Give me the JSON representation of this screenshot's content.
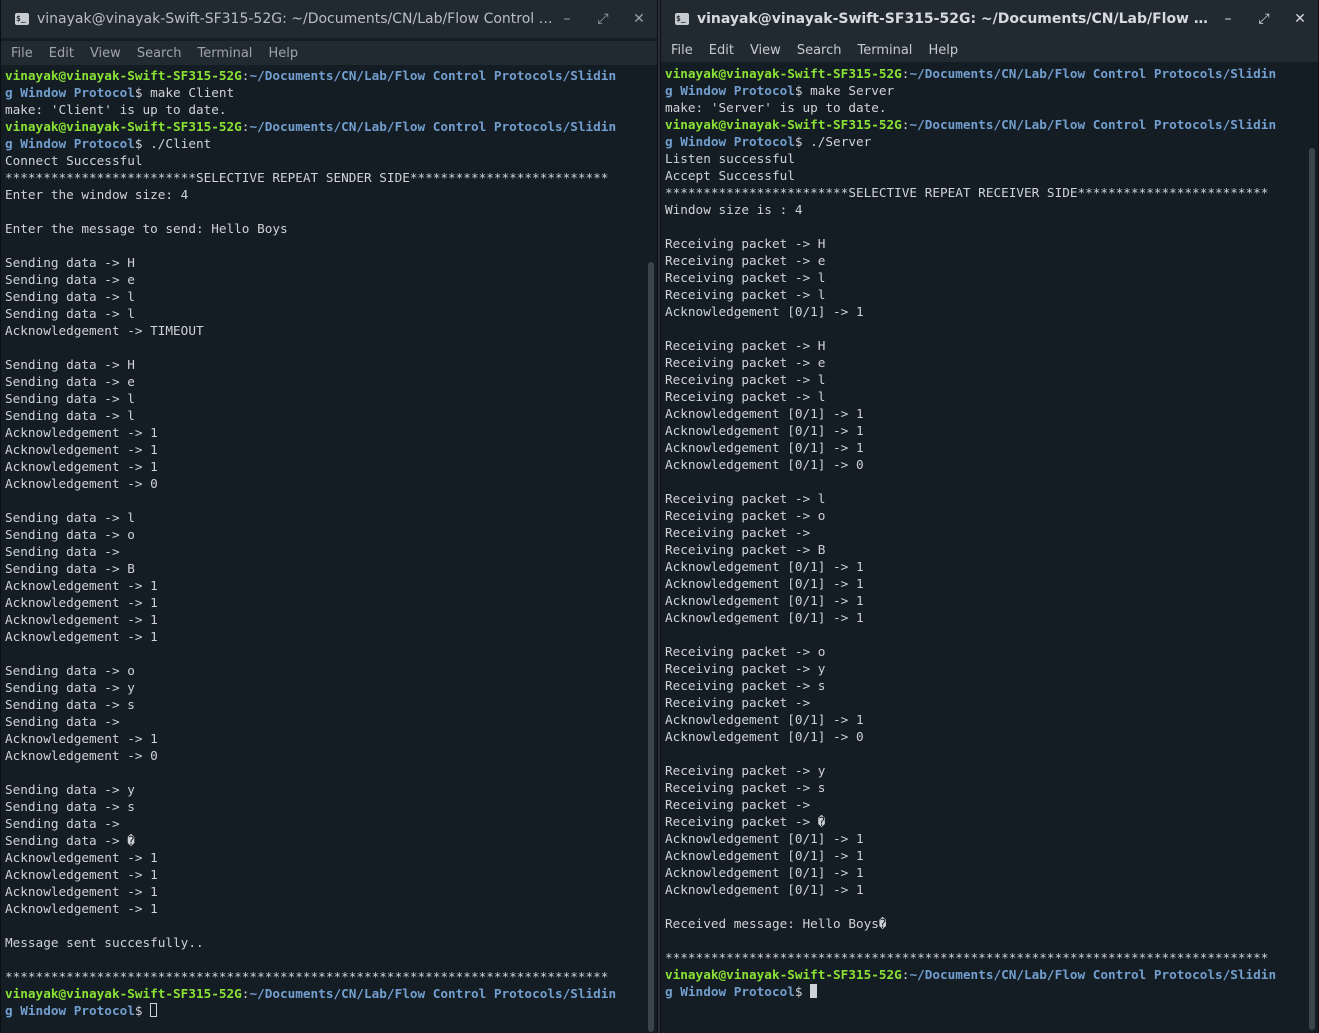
{
  "left": {
    "title": "vinayak@vinayak-Swift-SF315-52G: ~/Documents/CN/Lab/Flow Control Prot...",
    "icon": "terminal-icon",
    "menu": [
      "File",
      "Edit",
      "View",
      "Search",
      "Terminal",
      "Help"
    ],
    "lines": [
      {
        "type": "prompt",
        "user": "vinayak@vinayak-Swift-SF315-52G",
        "path": "~/Documents/CN/Lab/Flow Control Protocols/Slidin"
      },
      {
        "type": "prompt2",
        "path": "g Window Protocol",
        "cmd": "$ make Client"
      },
      {
        "type": "text",
        "text": "make: 'Client' is up to date."
      },
      {
        "type": "prompt",
        "user": "vinayak@vinayak-Swift-SF315-52G",
        "path": "~/Documents/CN/Lab/Flow Control Protocols/Slidin"
      },
      {
        "type": "prompt2",
        "path": "g Window Protocol",
        "cmd": "$ ./Client"
      },
      {
        "type": "text",
        "text": "Connect Successful"
      },
      {
        "type": "text",
        "text": "*************************SELECTIVE REPEAT SENDER SIDE**************************"
      },
      {
        "type": "text",
        "text": "Enter the window size: 4"
      },
      {
        "type": "text",
        "text": ""
      },
      {
        "type": "text",
        "text": "Enter the message to send: Hello Boys"
      },
      {
        "type": "text",
        "text": ""
      },
      {
        "type": "text",
        "text": "Sending data -> H"
      },
      {
        "type": "text",
        "text": "Sending data -> e"
      },
      {
        "type": "text",
        "text": "Sending data -> l"
      },
      {
        "type": "text",
        "text": "Sending data -> l"
      },
      {
        "type": "text",
        "text": "Acknowledgement -> TIMEOUT"
      },
      {
        "type": "text",
        "text": ""
      },
      {
        "type": "text",
        "text": "Sending data -> H"
      },
      {
        "type": "text",
        "text": "Sending data -> e"
      },
      {
        "type": "text",
        "text": "Sending data -> l"
      },
      {
        "type": "text",
        "text": "Sending data -> l"
      },
      {
        "type": "text",
        "text": "Acknowledgement -> 1"
      },
      {
        "type": "text",
        "text": "Acknowledgement -> 1"
      },
      {
        "type": "text",
        "text": "Acknowledgement -> 1"
      },
      {
        "type": "text",
        "text": "Acknowledgement -> 0"
      },
      {
        "type": "text",
        "text": ""
      },
      {
        "type": "text",
        "text": "Sending data -> l"
      },
      {
        "type": "text",
        "text": "Sending data -> o"
      },
      {
        "type": "text",
        "text": "Sending data -> "
      },
      {
        "type": "text",
        "text": "Sending data -> B"
      },
      {
        "type": "text",
        "text": "Acknowledgement -> 1"
      },
      {
        "type": "text",
        "text": "Acknowledgement -> 1"
      },
      {
        "type": "text",
        "text": "Acknowledgement -> 1"
      },
      {
        "type": "text",
        "text": "Acknowledgement -> 1"
      },
      {
        "type": "text",
        "text": ""
      },
      {
        "type": "text",
        "text": "Sending data -> o"
      },
      {
        "type": "text",
        "text": "Sending data -> y"
      },
      {
        "type": "text",
        "text": "Sending data -> s"
      },
      {
        "type": "text",
        "text": "Sending data -> "
      },
      {
        "type": "text",
        "text": "Acknowledgement -> 1"
      },
      {
        "type": "text",
        "text": "Acknowledgement -> 0"
      },
      {
        "type": "text",
        "text": ""
      },
      {
        "type": "text",
        "text": "Sending data -> y"
      },
      {
        "type": "text",
        "text": "Sending data -> s"
      },
      {
        "type": "text",
        "text": "Sending data -> "
      },
      {
        "type": "text",
        "text": "Sending data -> �"
      },
      {
        "type": "text",
        "text": "Acknowledgement -> 1"
      },
      {
        "type": "text",
        "text": "Acknowledgement -> 1"
      },
      {
        "type": "text",
        "text": "Acknowledgement -> 1"
      },
      {
        "type": "text",
        "text": "Acknowledgement -> 1"
      },
      {
        "type": "text",
        "text": ""
      },
      {
        "type": "text",
        "text": "Message sent succesfully.."
      },
      {
        "type": "text",
        "text": ""
      },
      {
        "type": "text",
        "text": "*******************************************************************************"
      },
      {
        "type": "prompt",
        "user": "vinayak@vinayak-Swift-SF315-52G",
        "path": "~/Documents/CN/Lab/Flow Control Protocols/Slidin"
      },
      {
        "type": "prompt2",
        "path": "g Window Protocol",
        "cmd": "$ ",
        "cursor": true
      }
    ]
  },
  "right": {
    "title": "vinayak@vinayak-Swift-SF315-52G: ~/Documents/CN/Lab/Flow Control Prot...",
    "icon": "terminal-icon",
    "menu": [
      "File",
      "Edit",
      "View",
      "Search",
      "Terminal",
      "Help"
    ],
    "lines": [
      {
        "type": "prompt",
        "user": "vinayak@vinayak-Swift-SF315-52G",
        "path": "~/Documents/CN/Lab/Flow Control Protocols/Slidin"
      },
      {
        "type": "prompt2",
        "path": "g Window Protocol",
        "cmd": "$ make Server"
      },
      {
        "type": "text",
        "text": "make: 'Server' is up to date."
      },
      {
        "type": "prompt",
        "user": "vinayak@vinayak-Swift-SF315-52G",
        "path": "~/Documents/CN/Lab/Flow Control Protocols/Slidin"
      },
      {
        "type": "prompt2",
        "path": "g Window Protocol",
        "cmd": "$ ./Server"
      },
      {
        "type": "text",
        "text": "Listen successful"
      },
      {
        "type": "text",
        "text": "Accept Successful"
      },
      {
        "type": "text",
        "text": "************************SELECTIVE REPEAT RECEIVER SIDE*************************"
      },
      {
        "type": "text",
        "text": "Window size is : 4"
      },
      {
        "type": "text",
        "text": ""
      },
      {
        "type": "text",
        "text": "Receiving packet -> H"
      },
      {
        "type": "text",
        "text": "Receiving packet -> e"
      },
      {
        "type": "text",
        "text": "Receiving packet -> l"
      },
      {
        "type": "text",
        "text": "Receiving packet -> l"
      },
      {
        "type": "text",
        "text": "Acknowledgement [0/1] -> 1"
      },
      {
        "type": "text",
        "text": ""
      },
      {
        "type": "text",
        "text": "Receiving packet -> H"
      },
      {
        "type": "text",
        "text": "Receiving packet -> e"
      },
      {
        "type": "text",
        "text": "Receiving packet -> l"
      },
      {
        "type": "text",
        "text": "Receiving packet -> l"
      },
      {
        "type": "text",
        "text": "Acknowledgement [0/1] -> 1"
      },
      {
        "type": "text",
        "text": "Acknowledgement [0/1] -> 1"
      },
      {
        "type": "text",
        "text": "Acknowledgement [0/1] -> 1"
      },
      {
        "type": "text",
        "text": "Acknowledgement [0/1] -> 0"
      },
      {
        "type": "text",
        "text": ""
      },
      {
        "type": "text",
        "text": "Receiving packet -> l"
      },
      {
        "type": "text",
        "text": "Receiving packet -> o"
      },
      {
        "type": "text",
        "text": "Receiving packet -> "
      },
      {
        "type": "text",
        "text": "Receiving packet -> B"
      },
      {
        "type": "text",
        "text": "Acknowledgement [0/1] -> 1"
      },
      {
        "type": "text",
        "text": "Acknowledgement [0/1] -> 1"
      },
      {
        "type": "text",
        "text": "Acknowledgement [0/1] -> 1"
      },
      {
        "type": "text",
        "text": "Acknowledgement [0/1] -> 1"
      },
      {
        "type": "text",
        "text": ""
      },
      {
        "type": "text",
        "text": "Receiving packet -> o"
      },
      {
        "type": "text",
        "text": "Receiving packet -> y"
      },
      {
        "type": "text",
        "text": "Receiving packet -> s"
      },
      {
        "type": "text",
        "text": "Receiving packet -> "
      },
      {
        "type": "text",
        "text": "Acknowledgement [0/1] -> 1"
      },
      {
        "type": "text",
        "text": "Acknowledgement [0/1] -> 0"
      },
      {
        "type": "text",
        "text": ""
      },
      {
        "type": "text",
        "text": "Receiving packet -> y"
      },
      {
        "type": "text",
        "text": "Receiving packet -> s"
      },
      {
        "type": "text",
        "text": "Receiving packet -> "
      },
      {
        "type": "text",
        "text": "Receiving packet -> �"
      },
      {
        "type": "text",
        "text": "Acknowledgement [0/1] -> 1"
      },
      {
        "type": "text",
        "text": "Acknowledgement [0/1] -> 1"
      },
      {
        "type": "text",
        "text": "Acknowledgement [0/1] -> 1"
      },
      {
        "type": "text",
        "text": "Acknowledgement [0/1] -> 1"
      },
      {
        "type": "text",
        "text": ""
      },
      {
        "type": "text",
        "text": "Received message: Hello Boys�"
      },
      {
        "type": "text",
        "text": ""
      },
      {
        "type": "text",
        "text": "*******************************************************************************"
      },
      {
        "type": "prompt",
        "user": "vinayak@vinayak-Swift-SF315-52G",
        "path": "~/Documents/CN/Lab/Flow Control Protocols/Slidin"
      },
      {
        "type": "prompt2",
        "path": "g Window Protocol",
        "cmd": "$ ",
        "cursor": true
      }
    ]
  },
  "window_buttons": {
    "minimize": "–",
    "maximize": "⤢",
    "close": "✕"
  },
  "colors": {
    "user": "#8ae234",
    "path": "#729fcf",
    "text": "#cfd3d7",
    "background": "#141c24",
    "titlebar": "#222a31"
  }
}
